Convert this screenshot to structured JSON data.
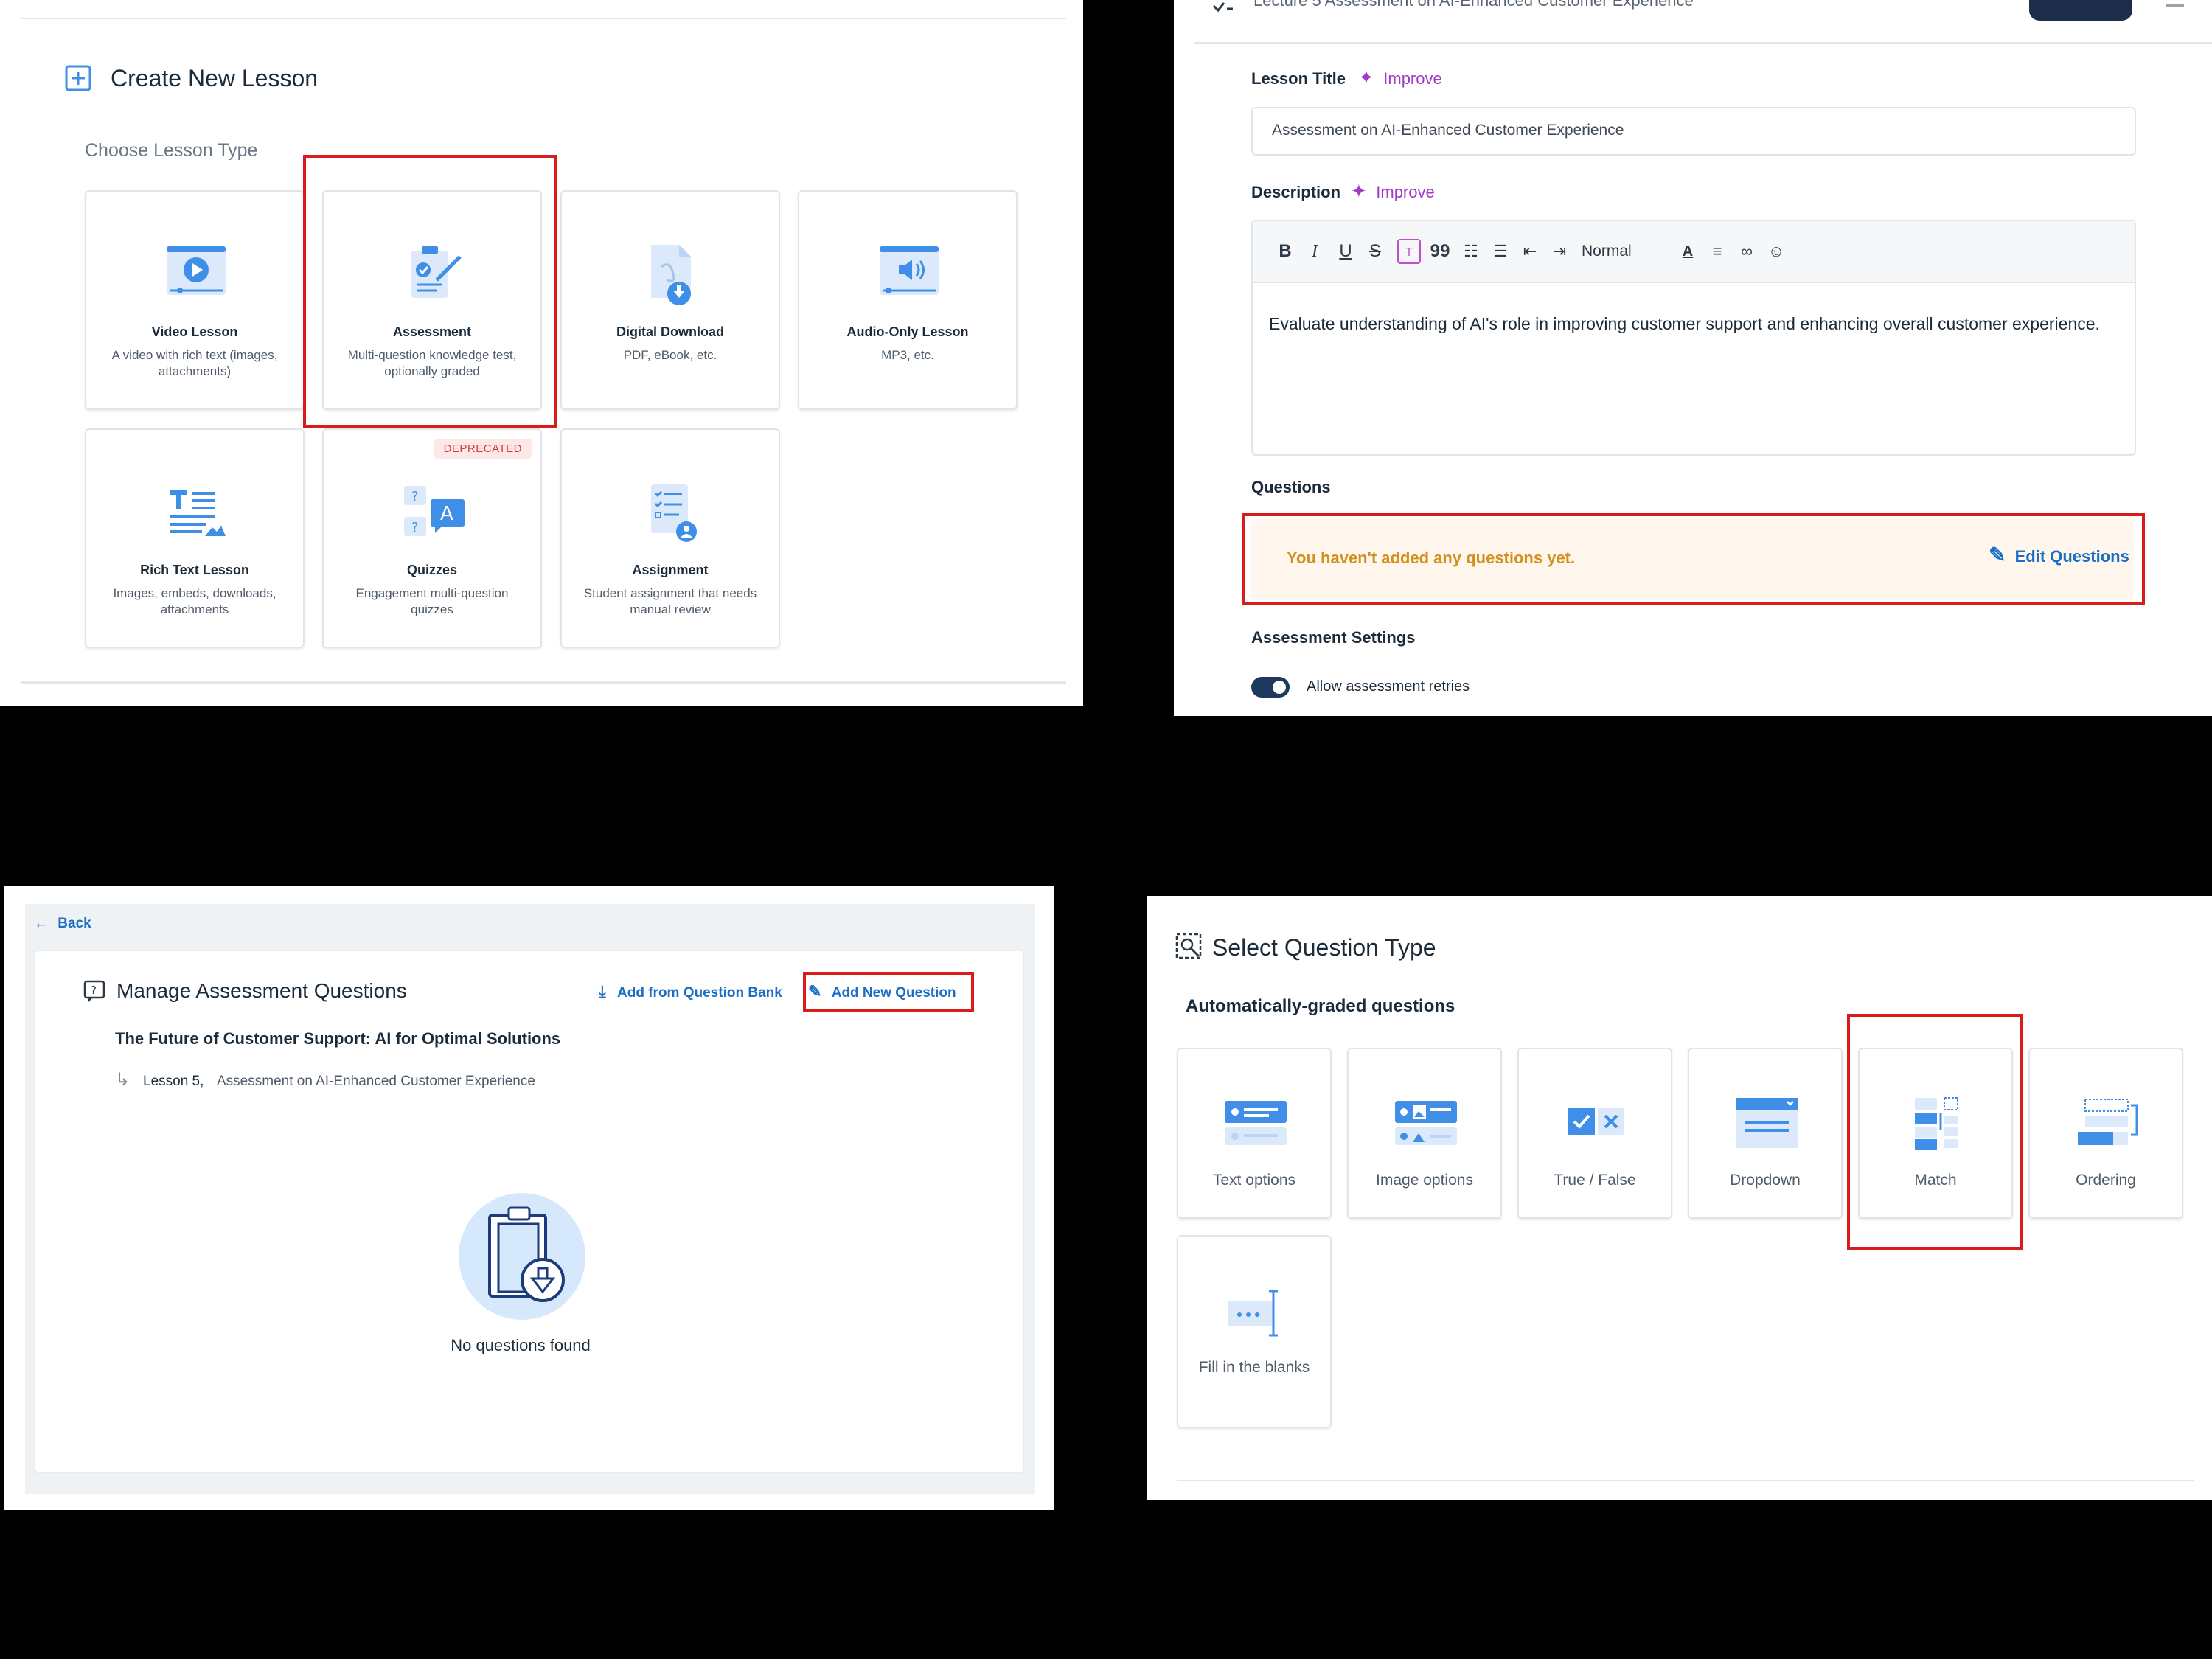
{
  "create_lesson": {
    "title": "Create New Lesson",
    "subtitle": "Choose Lesson Type",
    "types": [
      {
        "name": "Video Lesson",
        "desc": "A video with rich text (images, attachments)",
        "icon": "video-lesson-icon"
      },
      {
        "name": "Assessment",
        "desc": "Multi-question knowledge test, optionally graded",
        "icon": "assessment-icon"
      },
      {
        "name": "Digital Download",
        "desc": "PDF, eBook, etc.",
        "icon": "digital-download-icon"
      },
      {
        "name": "Audio-Only Lesson",
        "desc": "MP3, etc.",
        "icon": "audio-lesson-icon"
      },
      {
        "name": "Rich Text Lesson",
        "desc": "Images, embeds, downloads, attachments",
        "icon": "rich-text-icon"
      },
      {
        "name": "Quizzes",
        "desc": "Engagement multi-question quizzes",
        "icon": "quizzes-icon",
        "badge": "DEPRECATED"
      },
      {
        "name": "Assignment",
        "desc": "Student assignment that needs manual review",
        "icon": "assignment-icon"
      }
    ]
  },
  "lesson_editor": {
    "breadcrumb": "Lecture 5    Assessment on AI-Enhanced Customer Experience",
    "title_label": "Lesson Title",
    "improve_label": "Improve",
    "title_value": "Assessment on AI-Enhanced Customer Experience",
    "description_label": "Description",
    "format_select": "Normal",
    "description_value": "Evaluate understanding of AI's role in improving customer support and enhancing overall customer experience.",
    "questions_label": "Questions",
    "empty_questions": "You haven't added any questions yet.",
    "edit_questions": "Edit Questions",
    "settings_label": "Assessment Settings",
    "retries_label": "Allow assessment retries",
    "retries_on": true
  },
  "manage_questions": {
    "back": "Back",
    "title": "Manage Assessment Questions",
    "add_from_bank": "Add from Question Bank",
    "add_new": "Add New Question",
    "course": "The Future of Customer Support: AI for Optimal Solutions",
    "lesson_num": "Lesson 5,",
    "lesson_name": "Assessment on AI-Enhanced Customer Experience",
    "empty": "No questions found"
  },
  "question_types": {
    "title": "Select Question Type",
    "subtitle": "Automatically-graded questions",
    "types": [
      {
        "name": "Text options"
      },
      {
        "name": "Image options"
      },
      {
        "name": "True / False"
      },
      {
        "name": "Dropdown"
      },
      {
        "name": "Match"
      },
      {
        "name": "Ordering"
      },
      {
        "name": "Fill in the blanks"
      }
    ]
  },
  "colors": {
    "accent": "#1a6fc4",
    "icon_blue": "#3f8fe8",
    "highlight": "#d81b1b",
    "warning": "#d3901f"
  }
}
